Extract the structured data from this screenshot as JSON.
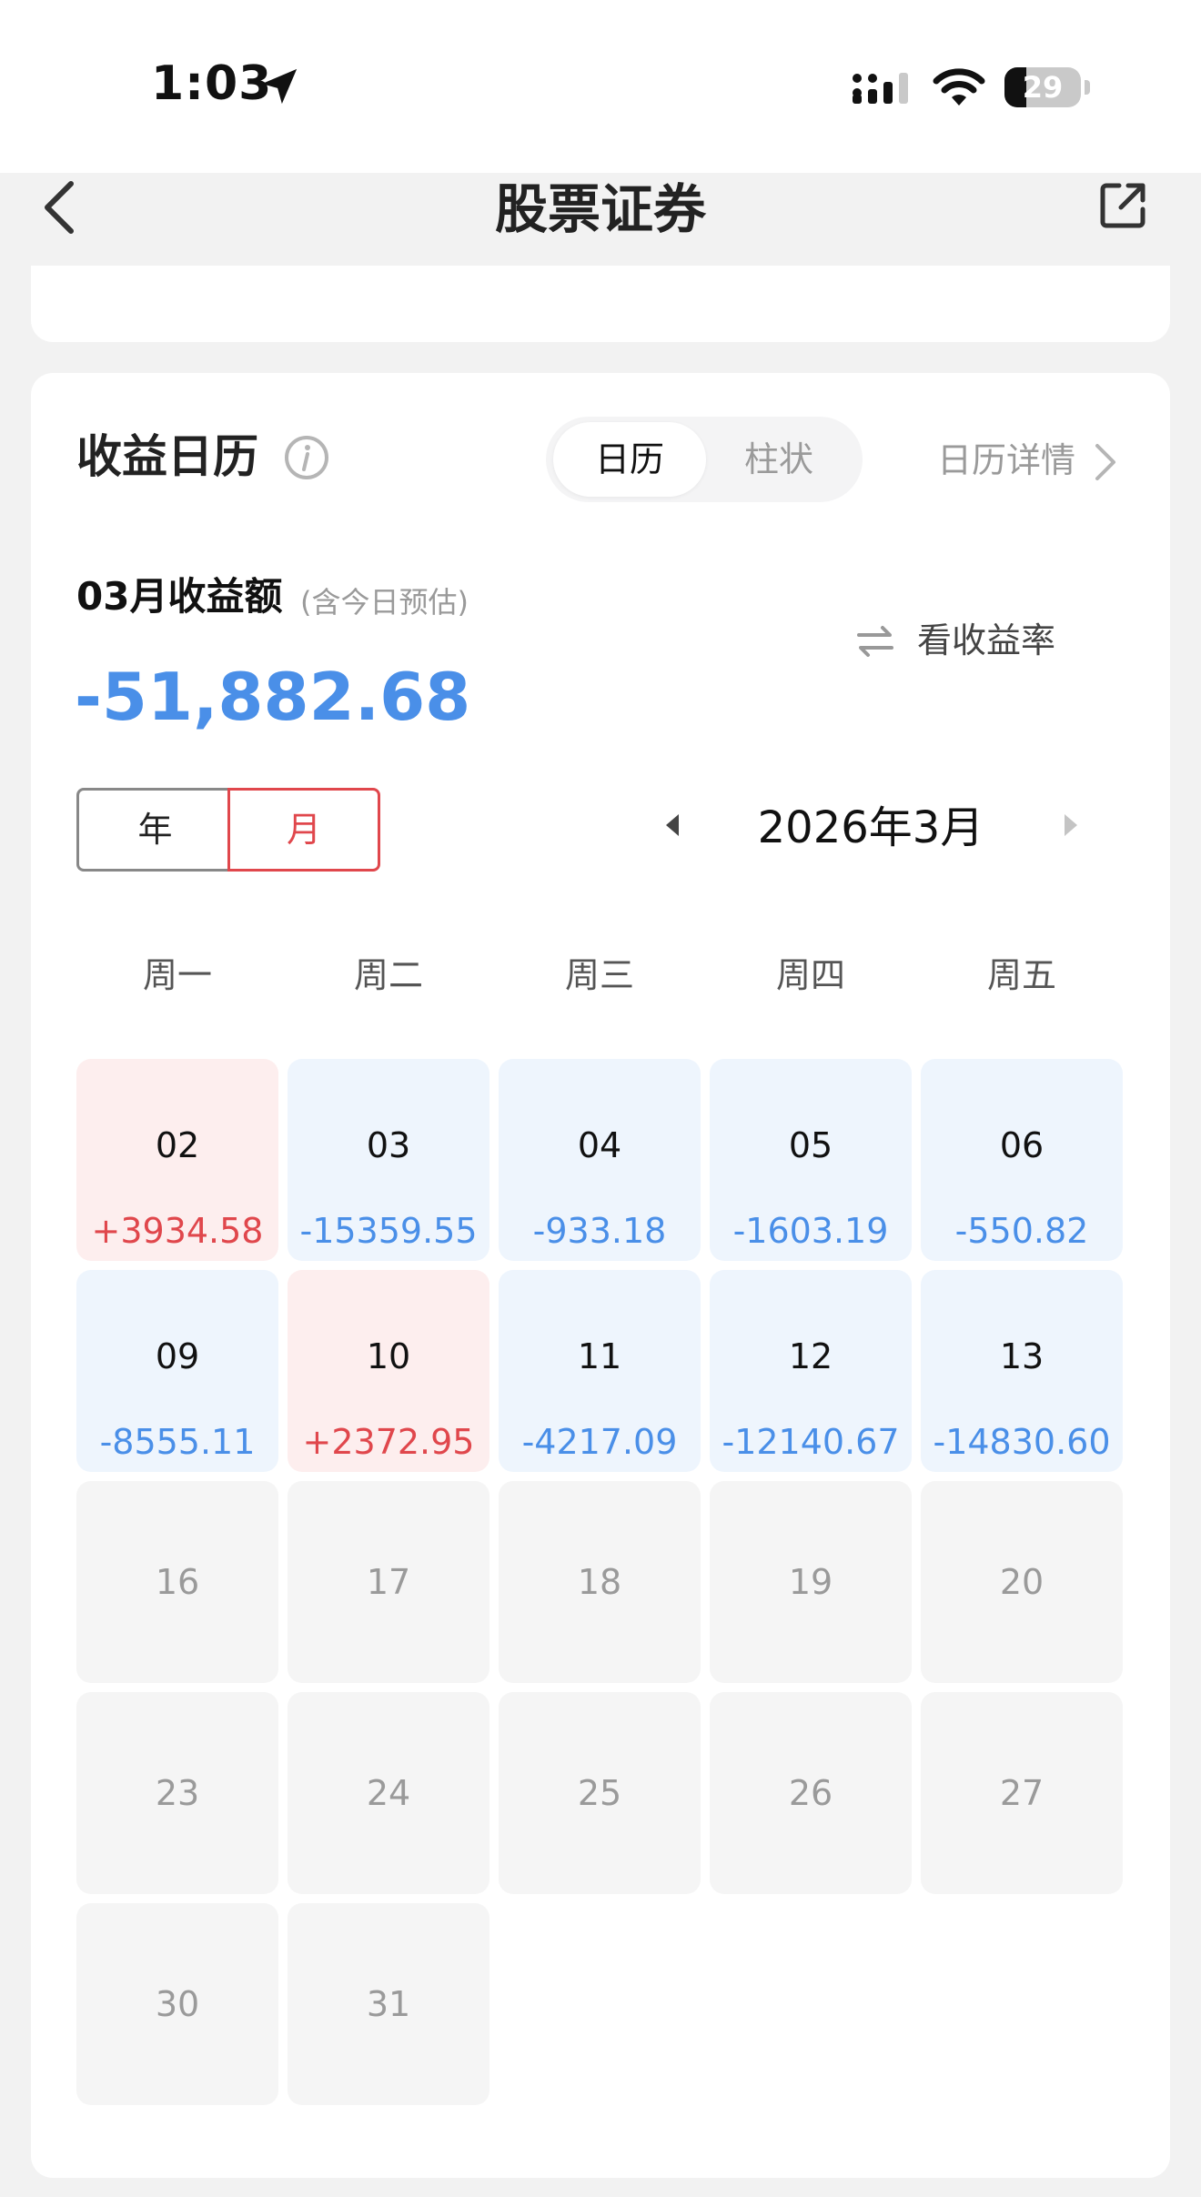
{
  "status_bar": {
    "time": "1:03",
    "battery": "29",
    "battery_level": 0.29
  },
  "nav": {
    "title": "股票证券"
  },
  "section": {
    "title": "收益日历",
    "view_options": [
      "日历",
      "柱状"
    ],
    "active_view": "日历",
    "detail_link": "日历详情"
  },
  "summary": {
    "label": "03月收益额",
    "note": "(含今日预估)",
    "value": "-51,882.68",
    "toggle_label": "看收益率"
  },
  "period": {
    "year": "年",
    "month": "月",
    "active": "月"
  },
  "calendar": {
    "month_label": "2026年3月",
    "weekdays": [
      "周一",
      "周二",
      "周三",
      "周四",
      "周五"
    ],
    "weeks": [
      [
        {
          "day": "02",
          "value": "+3934.58",
          "type": "gain"
        },
        {
          "day": "03",
          "value": "-15359.55",
          "type": "loss"
        },
        {
          "day": "04",
          "value": "-933.18",
          "type": "loss"
        },
        {
          "day": "05",
          "value": "-1603.19",
          "type": "loss"
        },
        {
          "day": "06",
          "value": "-550.82",
          "type": "loss"
        }
      ],
      [
        {
          "day": "09",
          "value": "-8555.11",
          "type": "loss"
        },
        {
          "day": "10",
          "value": "+2372.95",
          "type": "gain"
        },
        {
          "day": "11",
          "value": "-4217.09",
          "type": "loss"
        },
        {
          "day": "12",
          "value": "-12140.67",
          "type": "loss"
        },
        {
          "day": "13",
          "value": "-14830.60",
          "type": "loss"
        }
      ],
      [
        {
          "day": "16",
          "type": "empty"
        },
        {
          "day": "17",
          "type": "empty"
        },
        {
          "day": "18",
          "type": "empty"
        },
        {
          "day": "19",
          "type": "empty"
        },
        {
          "day": "20",
          "type": "empty"
        }
      ],
      [
        {
          "day": "23",
          "type": "empty"
        },
        {
          "day": "24",
          "type": "empty"
        },
        {
          "day": "25",
          "type": "empty"
        },
        {
          "day": "26",
          "type": "empty"
        },
        {
          "day": "27",
          "type": "empty"
        }
      ],
      [
        {
          "day": "30",
          "type": "empty"
        },
        {
          "day": "31",
          "type": "empty"
        }
      ]
    ]
  },
  "colors": {
    "gain": "#e0474c",
    "loss": "#4a8fe8",
    "gain_bg": "#fdeeee",
    "loss_bg": "#eef5fd",
    "empty_bg": "#f5f5f5"
  },
  "icons": [
    "location-arrow-icon",
    "signal-icon",
    "wifi-icon",
    "battery-icon",
    "back-chevron-icon",
    "share-icon",
    "info-icon",
    "chevron-right-icon",
    "swap-icon",
    "prev-month-icon",
    "next-month-icon"
  ]
}
